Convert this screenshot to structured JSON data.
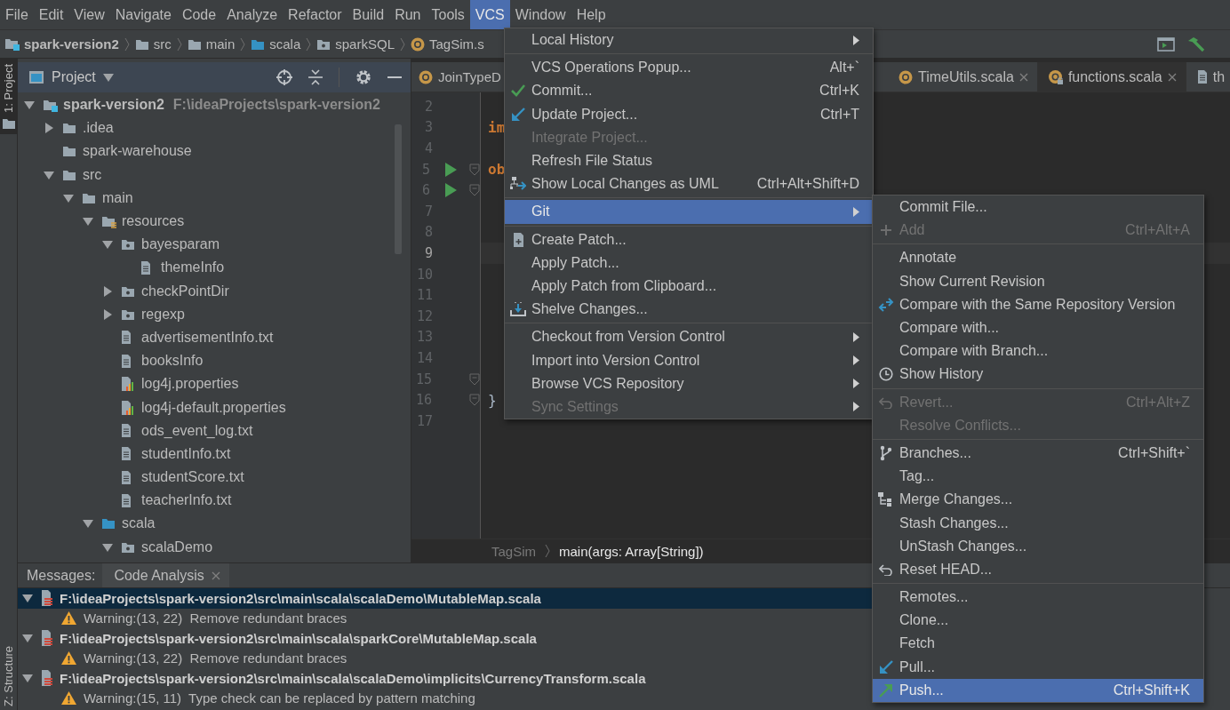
{
  "menu_bar": {
    "items": [
      {
        "label": "File",
        "selected": false
      },
      {
        "label": "Edit",
        "selected": false
      },
      {
        "label": "View",
        "selected": false
      },
      {
        "label": "Navigate",
        "selected": false
      },
      {
        "label": "Code",
        "selected": false
      },
      {
        "label": "Analyze",
        "selected": false
      },
      {
        "label": "Refactor",
        "selected": false
      },
      {
        "label": "Build",
        "selected": false
      },
      {
        "label": "Run",
        "selected": false
      },
      {
        "label": "Tools",
        "selected": false
      },
      {
        "label": "VCS",
        "selected": true
      },
      {
        "label": "Window",
        "selected": false
      },
      {
        "label": "Help",
        "selected": false
      }
    ]
  },
  "navigation_bar": {
    "crumbs": [
      {
        "label": "spark-version2",
        "kind": "module"
      },
      {
        "label": "src",
        "kind": "folder"
      },
      {
        "label": "main",
        "kind": "folder"
      },
      {
        "label": "scala",
        "kind": "source-folder"
      },
      {
        "label": "sparkSQL",
        "kind": "package"
      },
      {
        "label": "TagSim.s",
        "kind": "scala-file"
      }
    ]
  },
  "tool_strip": {
    "tabs": [
      {
        "label": "1: Project",
        "selected": true
      },
      {
        "label": "Z: Structure",
        "selected": false
      }
    ]
  },
  "project_panel": {
    "title": "Project",
    "tree": [
      {
        "label": "spark-version2",
        "hint": "F:\\ideaProjects\\spark-version2",
        "kind": "module",
        "expanded": true,
        "children": [
          {
            "label": ".idea",
            "kind": "folder",
            "expanded": false
          },
          {
            "label": "spark-warehouse",
            "kind": "folder"
          },
          {
            "label": "src",
            "kind": "folder",
            "expanded": true,
            "children": [
              {
                "label": "main",
                "kind": "folder",
                "expanded": true,
                "children": [
                  {
                    "label": "resources",
                    "kind": "resource-folder",
                    "expanded": true,
                    "children": [
                      {
                        "label": "bayesparam",
                        "kind": "package",
                        "expanded": true,
                        "children": [
                          {
                            "label": "themeInfo",
                            "kind": "text-file"
                          }
                        ]
                      },
                      {
                        "label": "checkPointDir",
                        "kind": "package",
                        "expanded": false
                      },
                      {
                        "label": "regexp",
                        "kind": "package",
                        "expanded": false
                      },
                      {
                        "label": "advertisementInfo.txt",
                        "kind": "text-file"
                      },
                      {
                        "label": "booksInfo",
                        "kind": "text-file"
                      },
                      {
                        "label": "log4j.properties",
                        "kind": "properties-file"
                      },
                      {
                        "label": "log4j-default.properties",
                        "kind": "properties-file"
                      },
                      {
                        "label": "ods_event_log.txt",
                        "kind": "text-file"
                      },
                      {
                        "label": "studentInfo.txt",
                        "kind": "text-file"
                      },
                      {
                        "label": "studentScore.txt",
                        "kind": "text-file"
                      },
                      {
                        "label": "teacherInfo.txt",
                        "kind": "text-file"
                      }
                    ]
                  },
                  {
                    "label": "scala",
                    "kind": "source-folder",
                    "expanded": true,
                    "children": [
                      {
                        "label": "scalaDemo",
                        "kind": "package",
                        "expanded": true
                      }
                    ]
                  }
                ]
              }
            ]
          }
        ]
      }
    ]
  },
  "editor": {
    "tabs": [
      {
        "label": "JoinTypeD",
        "kind": "scala-file",
        "closable": false,
        "locked": false,
        "selected": false
      },
      {
        "label": "TimeUtils.scala",
        "kind": "scala-file",
        "closable": true,
        "locked": false,
        "selected": false
      },
      {
        "label": "functions.scala",
        "kind": "scala-file",
        "closable": true,
        "locked": true,
        "selected": true
      },
      {
        "label": "th",
        "kind": "text-file",
        "closable": false,
        "locked": false,
        "selected": false
      }
    ],
    "lines": [
      {
        "number": "2",
        "run": false,
        "fold": false,
        "current": false
      },
      {
        "number": "3",
        "code": "im",
        "run": false,
        "fold": false,
        "current": false
      },
      {
        "number": "4",
        "run": false,
        "fold": false,
        "current": false
      },
      {
        "number": "5",
        "code": "ob",
        "run": true,
        "fold": true,
        "current": false
      },
      {
        "number": "6",
        "run": true,
        "fold": true,
        "current": false
      },
      {
        "number": "7",
        "run": false,
        "fold": false,
        "current": false
      },
      {
        "number": "8",
        "run": false,
        "fold": false,
        "current": false
      },
      {
        "number": "9",
        "run": false,
        "fold": false,
        "current": true
      },
      {
        "number": "10",
        "run": false,
        "fold": false,
        "current": false
      },
      {
        "number": "11",
        "run": false,
        "fold": false,
        "current": false
      },
      {
        "number": "12",
        "run": false,
        "fold": false,
        "current": false
      },
      {
        "number": "13",
        "run": false,
        "fold": false,
        "current": false
      },
      {
        "number": "14",
        "run": false,
        "fold": false,
        "current": false
      },
      {
        "number": "15",
        "run": false,
        "fold": true,
        "current": false
      },
      {
        "number": "16",
        "code": "}",
        "run": false,
        "fold": true,
        "current": false
      },
      {
        "number": "17",
        "run": false,
        "fold": false,
        "current": false
      }
    ],
    "breadcrumbs": [
      "TagSim",
      "main(args: Array[String])"
    ]
  },
  "messages_panel": {
    "label": "Messages:",
    "tabs": [
      {
        "label": "Code Analysis",
        "selected": true
      }
    ],
    "rows": [
      {
        "kind": "file",
        "text": "F:\\ideaProjects\\spark-version2\\src\\main\\scala\\scalaDemo\\MutableMap.scala",
        "selected": true
      },
      {
        "kind": "warning",
        "text": "Warning:(13, 22)  Remove redundant braces",
        "selected": false
      },
      {
        "kind": "file",
        "text": "F:\\ideaProjects\\spark-version2\\src\\main\\scala\\sparkCore\\MutableMap.scala",
        "selected": false
      },
      {
        "kind": "warning",
        "text": "Warning:(13, 22)  Remove redundant braces",
        "selected": false
      },
      {
        "kind": "file",
        "text": "F:\\ideaProjects\\spark-version2\\src\\main\\scala\\scalaDemo\\implicits\\CurrencyTransform.scala",
        "selected": false
      },
      {
        "kind": "warning",
        "text": "Warning:(15, 11)  Type check can be replaced by pattern matching",
        "selected": false
      }
    ]
  },
  "vcs_menu": {
    "groups": [
      {
        "items": [
          {
            "label": "Local History",
            "disabled": false,
            "selected": false,
            "submenu": true
          }
        ]
      },
      {
        "items": [
          {
            "label": "VCS Operations Popup...",
            "shortcut": "Alt+`",
            "disabled": false,
            "selected": false,
            "submenu": false
          },
          {
            "label": "Commit...",
            "shortcut": "Ctrl+K",
            "disabled": false,
            "selected": false,
            "submenu": false
          },
          {
            "label": "Update Project...",
            "shortcut": "Ctrl+T",
            "disabled": false,
            "selected": false,
            "submenu": false
          },
          {
            "label": "Integrate Project...",
            "disabled": true,
            "selected": false,
            "submenu": false
          },
          {
            "label": "Refresh File Status",
            "disabled": false,
            "selected": false,
            "submenu": false
          },
          {
            "label": "Show Local Changes as UML",
            "shortcut": "Ctrl+Alt+Shift+D",
            "disabled": false,
            "selected": false,
            "submenu": false
          }
        ]
      },
      {
        "items": [
          {
            "label": "Git",
            "disabled": false,
            "selected": true,
            "submenu": true
          }
        ]
      },
      {
        "items": [
          {
            "label": "Create Patch...",
            "disabled": false,
            "selected": false,
            "submenu": false
          },
          {
            "label": "Apply Patch...",
            "disabled": false,
            "selected": false,
            "submenu": false
          },
          {
            "label": "Apply Patch from Clipboard...",
            "disabled": false,
            "selected": false,
            "submenu": false
          },
          {
            "label": "Shelve Changes...",
            "disabled": false,
            "selected": false,
            "submenu": false
          }
        ]
      },
      {
        "items": [
          {
            "label": "Checkout from Version Control",
            "disabled": false,
            "selected": false,
            "submenu": true
          },
          {
            "label": "Import into Version Control",
            "disabled": false,
            "selected": false,
            "submenu": true
          },
          {
            "label": "Browse VCS Repository",
            "disabled": false,
            "selected": false,
            "submenu": true
          },
          {
            "label": "Sync Settings",
            "disabled": true,
            "selected": false,
            "submenu": true
          }
        ]
      }
    ]
  },
  "git_menu": {
    "groups": [
      {
        "items": [
          {
            "label": "Commit File...",
            "disabled": false,
            "selected": false
          },
          {
            "label": "Add",
            "shortcut": "Ctrl+Alt+A",
            "disabled": true,
            "selected": false
          }
        ]
      },
      {
        "items": [
          {
            "label": "Annotate",
            "disabled": false,
            "selected": false
          },
          {
            "label": "Show Current Revision",
            "disabled": false,
            "selected": false
          },
          {
            "label": "Compare with the Same Repository Version",
            "disabled": false,
            "selected": false
          },
          {
            "label": "Compare with...",
            "disabled": false,
            "selected": false
          },
          {
            "label": "Compare with Branch...",
            "disabled": false,
            "selected": false
          },
          {
            "label": "Show History",
            "disabled": false,
            "selected": false
          }
        ]
      },
      {
        "items": [
          {
            "label": "Revert...",
            "shortcut": "Ctrl+Alt+Z",
            "disabled": true,
            "selected": false
          },
          {
            "label": "Resolve Conflicts...",
            "disabled": true,
            "selected": false
          }
        ]
      },
      {
        "items": [
          {
            "label": "Branches...",
            "shortcut": "Ctrl+Shift+`",
            "disabled": false,
            "selected": false
          },
          {
            "label": "Tag...",
            "disabled": false,
            "selected": false
          },
          {
            "label": "Merge Changes...",
            "disabled": false,
            "selected": false
          },
          {
            "label": "Stash Changes...",
            "disabled": false,
            "selected": false
          },
          {
            "label": "UnStash Changes...",
            "disabled": false,
            "selected": false
          },
          {
            "label": "Reset HEAD...",
            "disabled": false,
            "selected": false
          }
        ]
      },
      {
        "items": [
          {
            "label": "Remotes...",
            "disabled": false,
            "selected": false
          },
          {
            "label": "Clone...",
            "disabled": false,
            "selected": false
          },
          {
            "label": "Fetch",
            "disabled": false,
            "selected": false
          },
          {
            "label": "Pull...",
            "disabled": false,
            "selected": false
          },
          {
            "label": "Push...",
            "shortcut": "Ctrl+Shift+K",
            "disabled": false,
            "selected": true
          }
        ]
      }
    ]
  }
}
